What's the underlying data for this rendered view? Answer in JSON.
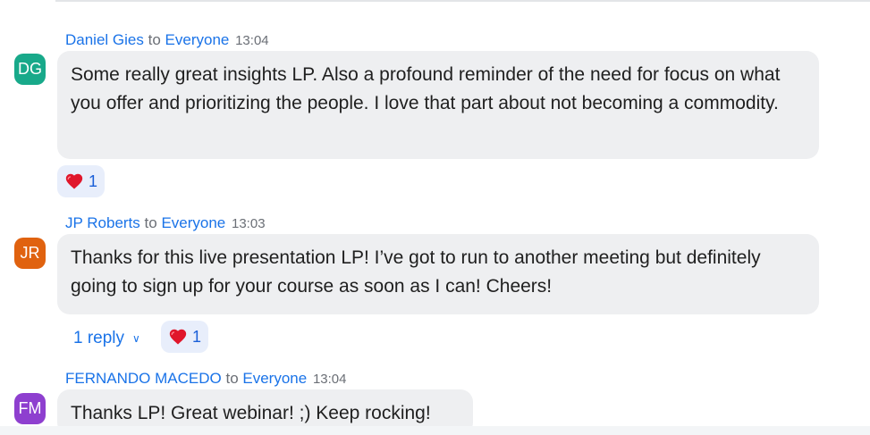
{
  "messages": [
    {
      "sender": "Daniel Gies",
      "to_word": "to",
      "recipient": "Everyone",
      "time": "13:04",
      "avatar_initials": "DG",
      "avatar_color": "#18a98a",
      "text": "Some really great insights LP. Also a profound reminder of the need for focus on what you offer and prioritizing the people. I love that part about not becoming a commodity.",
      "reaction": {
        "icon": "heart-icon",
        "count": "1"
      }
    },
    {
      "sender": "JP Roberts",
      "to_word": "to",
      "recipient": "Everyone",
      "time": "13:03",
      "avatar_initials": "JR",
      "avatar_color": "#e0620f",
      "text": "Thanks for this live presentation LP! I’ve got to run to another meeting but definitely going to sign up for your course as soon as I can! Cheers!",
      "reply_label": "1 reply",
      "reaction": {
        "icon": "heart-icon",
        "count": "1"
      }
    },
    {
      "sender": "FERNANDO MACEDO",
      "to_word": "to",
      "recipient": "Everyone",
      "time": "13:04",
      "avatar_initials": "FM",
      "avatar_color": "#8e3fcf",
      "text": "Thanks LP! Great webinar! ;) Keep rocking!"
    }
  ],
  "colors": {
    "link": "#1a73e8",
    "bubble": "#eeeff1",
    "reaction_bg": "#e8eefb",
    "heart": "#e0162b"
  }
}
